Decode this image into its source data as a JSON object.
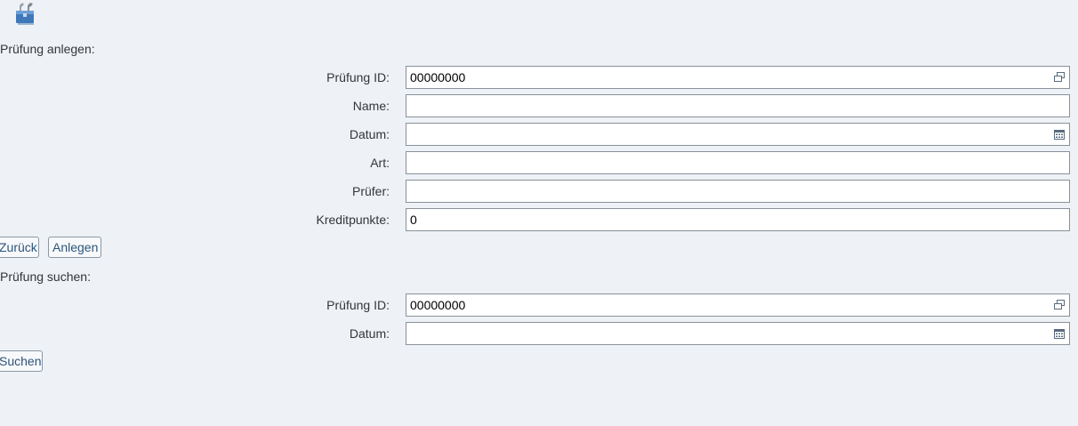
{
  "create_section": {
    "title": "Prüfung anlegen:",
    "fields": [
      {
        "label": "Prüfung ID:",
        "value": "00000000",
        "help": "value-help-icon"
      },
      {
        "label": "Name:",
        "value": ""
      },
      {
        "label": "Datum:",
        "value": "",
        "help": "calendar-icon"
      },
      {
        "label": "Art:",
        "value": ""
      },
      {
        "label": "Prüfer:",
        "value": ""
      },
      {
        "label": "Kreditpunkte:",
        "value": "0"
      }
    ],
    "buttons": {
      "back": "Zurück",
      "create": "Anlegen"
    }
  },
  "search_section": {
    "title": "Prüfung suchen:",
    "fields": [
      {
        "label": "Prüfung ID:",
        "value": "00000000",
        "help": "value-help-icon"
      },
      {
        "label": "Datum:",
        "value": "",
        "help": "calendar-icon"
      }
    ],
    "buttons": {
      "search": "Suchen"
    }
  },
  "colors": {
    "background": "#eef2f6",
    "field_border": "#89919a",
    "button_text": "#2c5478",
    "help_icon": "#5a6b7d"
  }
}
